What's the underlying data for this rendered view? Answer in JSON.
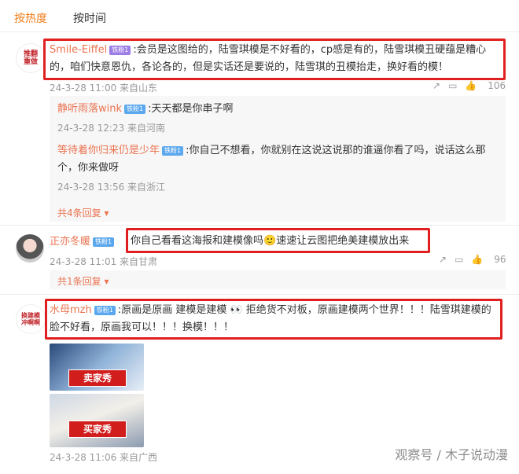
{
  "tabs": {
    "hot": "按热度",
    "time": "按时间"
  },
  "comments": [
    {
      "avatar_text": "推翻重做",
      "user": "Smile-Eiffel",
      "badge": "铁粉1",
      "text": ":会员是这图给的，陆雪琪模是不好看的，cp感是有的，陆雪琪模丑硬蕴是糟心的，咱们快意恩仇，各论各的，但是实话还是要说的，陆雪琪的丑模抬走，换好看的模！",
      "meta": "24-3-28 11:00 来自山东",
      "likes": "106",
      "replies": [
        {
          "user": "静听雨落wink",
          "badge": "铁粉1",
          "text": ":天天都是你串子啊",
          "meta": "24-3-28 12:23 来自河南"
        },
        {
          "user": "等待着你归来仍是少年",
          "badge": "铁粉1",
          "text": ":你自己不想看，你就别在这说这说那的谁逼你看了吗，说话这么那个，你来做呀",
          "meta": "24-3-28 13:56 来自浙江"
        }
      ],
      "more": "共4条回复"
    },
    {
      "user": "正亦冬暖",
      "badge": "铁粉1",
      "text": "你自己看看这海报和建模像吗",
      "emoji": "🙂",
      "text2": "速速让云图把绝美建模放出来",
      "meta": "24-3-28 11:01 来自甘肃",
      "likes": "96",
      "more": "共1条回复"
    },
    {
      "avatar_text": "换建模冲啊啊",
      "user": "水母mzh",
      "badge": "铁粉1",
      "text": ":原画是原画 建模是建模 👀 拒绝货不对板，原画建模两个世界！！！陆雪琪建模的脸不好看，原画我可以！！！换模！！！",
      "meta": "24-3-28 11:06 来自广西",
      "images": [
        {
          "tag": "卖家秀"
        },
        {
          "tag": "买家秀"
        }
      ]
    }
  ],
  "watermark": "观察号 / 木子说动漫",
  "colors": {
    "accent": "#f07d1a",
    "username": "#eb7350",
    "highlight": "#e02020"
  }
}
